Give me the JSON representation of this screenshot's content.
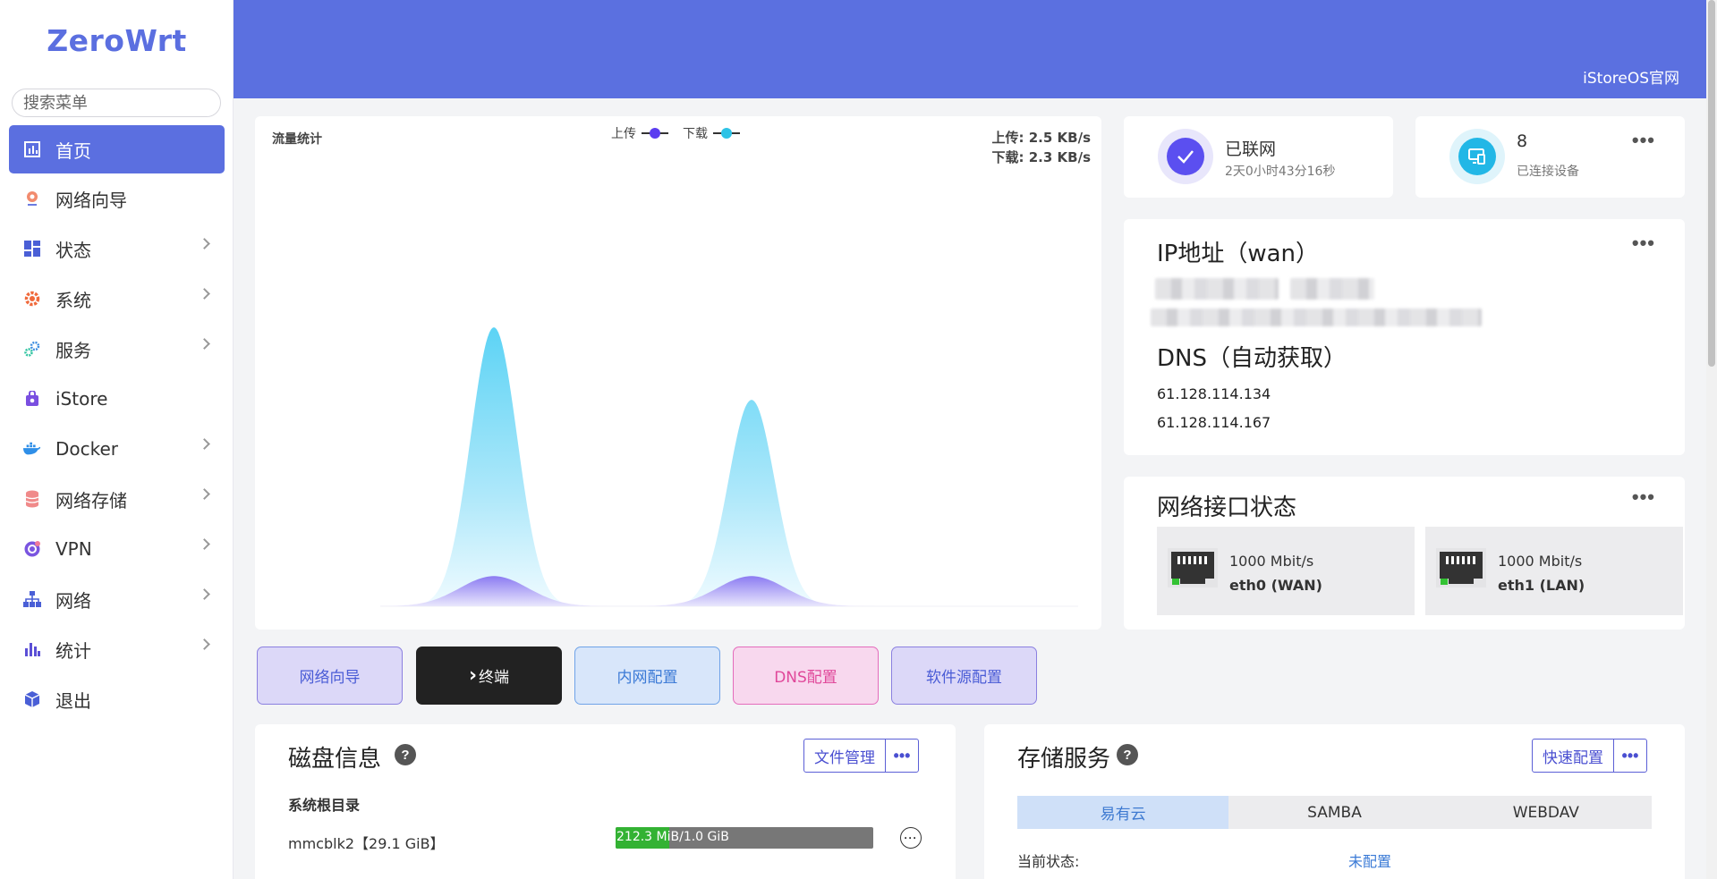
{
  "brand": "ZeroWrt",
  "search": {
    "placeholder": "搜索菜单"
  },
  "sidebar": {
    "items": [
      {
        "label": "首页",
        "icon": "dashboard-icon",
        "active": true,
        "chevron": false
      },
      {
        "label": "网络向导",
        "icon": "globe-pin-icon",
        "chevron": false
      },
      {
        "label": "状态",
        "icon": "grid-icon",
        "chevron": true
      },
      {
        "label": "系统",
        "icon": "gear-icon",
        "chevron": true
      },
      {
        "label": "服务",
        "icon": "gears-icon",
        "chevron": true
      },
      {
        "label": "iStore",
        "icon": "bag-icon",
        "chevron": false
      },
      {
        "label": "Docker",
        "icon": "docker-icon",
        "chevron": true
      },
      {
        "label": "网络存储",
        "icon": "database-icon",
        "chevron": true
      },
      {
        "label": "VPN",
        "icon": "vpn-icon",
        "chevron": true
      },
      {
        "label": "网络",
        "icon": "network-tree-icon",
        "chevron": true
      },
      {
        "label": "统计",
        "icon": "bar-chart-icon",
        "chevron": true
      },
      {
        "label": "退出",
        "icon": "cube-icon",
        "chevron": false
      }
    ]
  },
  "header": {
    "link": "iStoreOS官网"
  },
  "traffic": {
    "title": "流量统计",
    "legend": [
      {
        "name": "上传",
        "color": "#5b3df0"
      },
      {
        "name": "下载",
        "color": "#2ec3e6"
      }
    ],
    "upload_rate": "上传: 2.5 KB/s",
    "download_rate": "下载: 2.3 KB/s"
  },
  "chart_data": {
    "type": "area",
    "title": "流量统计",
    "series": [
      {
        "name": "上传",
        "peaks": [
          0.03,
          0.03
        ]
      },
      {
        "name": "下载",
        "peaks": [
          1.0,
          0.74
        ]
      }
    ],
    "grid": false,
    "legend_position": "top-center"
  },
  "online": {
    "title": "已联网",
    "uptime": "2天0小时43分16秒",
    "color": "#5b4ff0"
  },
  "devices": {
    "count": "8",
    "label": "已连接设备",
    "color": "#22b7e6"
  },
  "ip": {
    "title": "IP地址（wan）",
    "dns_title": "DNS（自动获取）",
    "dns": [
      "61.128.114.134",
      "61.128.114.167"
    ]
  },
  "net": {
    "title": "网络接口状态",
    "ports": [
      {
        "speed": "1000 Mbit/s",
        "name": "eth0 (WAN)"
      },
      {
        "speed": "1000 Mbit/s",
        "name": "eth1 (LAN)"
      }
    ]
  },
  "quick": [
    {
      "label": "网络向导",
      "bg": "#dcd8f8",
      "border": "#8b80e0",
      "color": "#4a5cd6"
    },
    {
      "label": "终端",
      "prefix": "›",
      "bg": "#222222",
      "border": "#222222",
      "color": "#ffffff"
    },
    {
      "label": "内网配置",
      "bg": "#d8e6fa",
      "border": "#6fa3e8",
      "color": "#3b7ad6"
    },
    {
      "label": "DNS配置",
      "bg": "#f8d8ee",
      "border": "#e46cbc",
      "color": "#e0489a"
    },
    {
      "label": "软件源配置",
      "bg": "#dcd8f8",
      "border": "#8b80e0",
      "color": "#4a5cd6"
    }
  ],
  "disk": {
    "title": "磁盘信息",
    "btn": "文件管理",
    "root_label": "系统根目录",
    "device": "mmcblk2【29.1 GiB】",
    "usage_text": "212.3 MiB/1.0 GiB",
    "usage_fraction": 0.21
  },
  "store": {
    "title": "存储服务",
    "btn": "快速配置",
    "tabs": [
      "易有云",
      "SAMBA",
      "WEBDAV"
    ],
    "status_label": "当前状态:",
    "status_value": "未配置"
  },
  "more_label": "•••"
}
